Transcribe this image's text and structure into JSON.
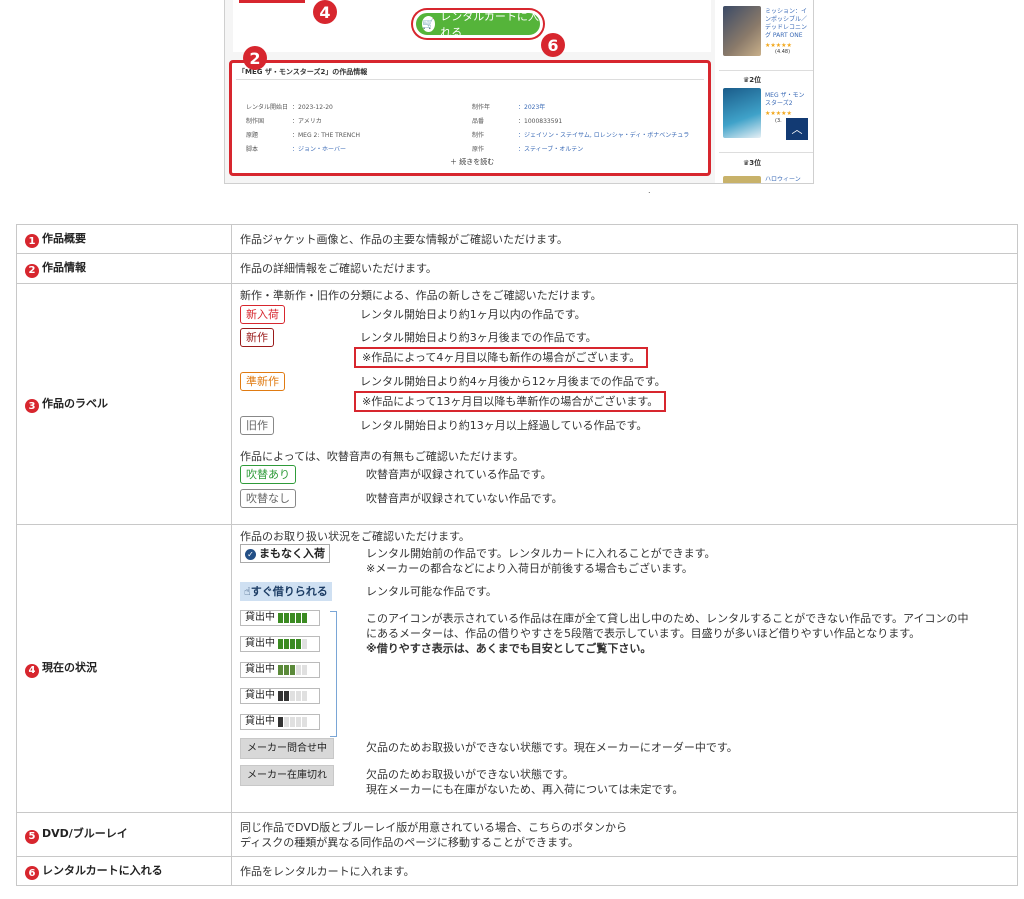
{
  "screenshot": {
    "cart_button": "レンタルカートに入れる",
    "badges": [
      "2",
      "4",
      "6"
    ],
    "info_title": "「MEG ザ・モンスターズ2」の作品情報",
    "info_rows": [
      {
        "k1": "レンタル開始日",
        "v1": "：2023-12-20",
        "k2": "制作年",
        "v2": "：2023年"
      },
      {
        "k1": "制作国",
        "v1": "：アメリカ",
        "k2": "品番",
        "v2": "：1000833591"
      },
      {
        "k1": "原題",
        "v1": "：MEG 2: THE TRENCH",
        "k2": "制作",
        "v2": "：ジェイソン・ステイサム, ロレンシャ・ディ・ボナベンチュラ"
      },
      {
        "k1": "脚本",
        "v1": "：ジョン・ホーバー",
        "k2": "原作",
        "v2": "：スティーブ・オルテン"
      }
    ],
    "read_more": "＋ 続きを読む",
    "side_items": [
      {
        "title": "ミッション：インポッシブル／デッドレコニング PART ONE",
        "stars": "★★★★★",
        "score": "(4.48)"
      },
      {
        "title": "MEG ザ・モンスターズ2",
        "stars": "★★★★★",
        "score": "(3."
      }
    ],
    "ranks": [
      "2位",
      "3位"
    ],
    "side_more": "ハロウィーン"
  },
  "table": {
    "rows": [
      {
        "num": "1",
        "head": "作品概要",
        "desc": "作品ジャケット画像と、作品の主要な情報がご確認いただけます。"
      },
      {
        "num": "2",
        "head": "作品情報",
        "desc": "作品の詳細情報をご確認いただけます。"
      },
      {
        "num": "3",
        "head": "作品のラベル"
      },
      {
        "num": "4",
        "head": "現在の状況"
      },
      {
        "num": "5",
        "head": "DVD/ブルーレイ",
        "desc_lines": [
          "同じ作品でDVD版とブルーレイ版が用意されている場合、こちらのボタンから",
          "ディスクの種類が異なる同作品のページに移動することができます。"
        ]
      },
      {
        "num": "6",
        "head": "レンタルカートに入れる",
        "desc": "作品をレンタルカートに入れます。"
      }
    ],
    "labels": {
      "intro": "新作・準新作・旧作の分類による、作品の新しさをご確認いただけます。",
      "items": [
        {
          "tag": "新入荷",
          "text": "レンタル開始日より約1ヶ月以内の作品です。"
        },
        {
          "tag": "新作",
          "text": "レンタル開始日より約3ヶ月後までの作品です。",
          "note": "※作品によって4ヶ月目以降も新作の場合がございます。"
        },
        {
          "tag": "準新作",
          "text": "レンタル開始日より約4ヶ月後から12ヶ月後までの作品です。",
          "note": "※作品によって13ヶ月目以降も準新作の場合がございます。"
        },
        {
          "tag": "旧作",
          "text": "レンタル開始日より約13ヶ月以上経過している作品です。"
        }
      ],
      "dub_intro": "作品によっては、吹替音声の有無もご確認いただけます。",
      "dub_items": [
        {
          "tag": "吹替あり",
          "text": "吹替音声が収録されている作品です。"
        },
        {
          "tag": "吹替なし",
          "text": "吹替音声が収録されていない作品です。"
        }
      ]
    },
    "status": {
      "intro": "作品のお取り扱い状況をご確認いただけます。",
      "soon_label": "まもなく入荷",
      "soon_text1": "レンタル開始前の作品です。レンタルカートに入れることができます。",
      "soon_text2": "※メーカーの都合などにより入荷日が前後する場合もございます。",
      "borrow_label": "すぐ借りられる",
      "borrow_text": "レンタル可能な作品です。",
      "lend_label": "貸出中",
      "lend_levels": [
        5,
        4,
        3,
        2,
        1
      ],
      "lend_text1": "このアイコンが表示されている作品は在庫が全て貸し出し中のため、レンタルすることができない作品です。アイコンの中",
      "lend_text2": "にあるメーターは、作品の借りやすさを5段階で表示しています。目盛りが多いほど借りやすい作品となります。",
      "lend_text3": "※借りやすさ表示は、あくまでも目安としてご覧下さい。",
      "maker_order_label": "メーカー問合せ中",
      "maker_order_text": "欠品のためお取扱いができない状態です。現在メーカーにオーダー中です。",
      "maker_out_label": "メーカー在庫切れ",
      "maker_out_text1": "欠品のためお取扱いができない状態です。",
      "maker_out_text2": "現在メーカーにも在庫がないため、再入荷については未定です。"
    }
  }
}
